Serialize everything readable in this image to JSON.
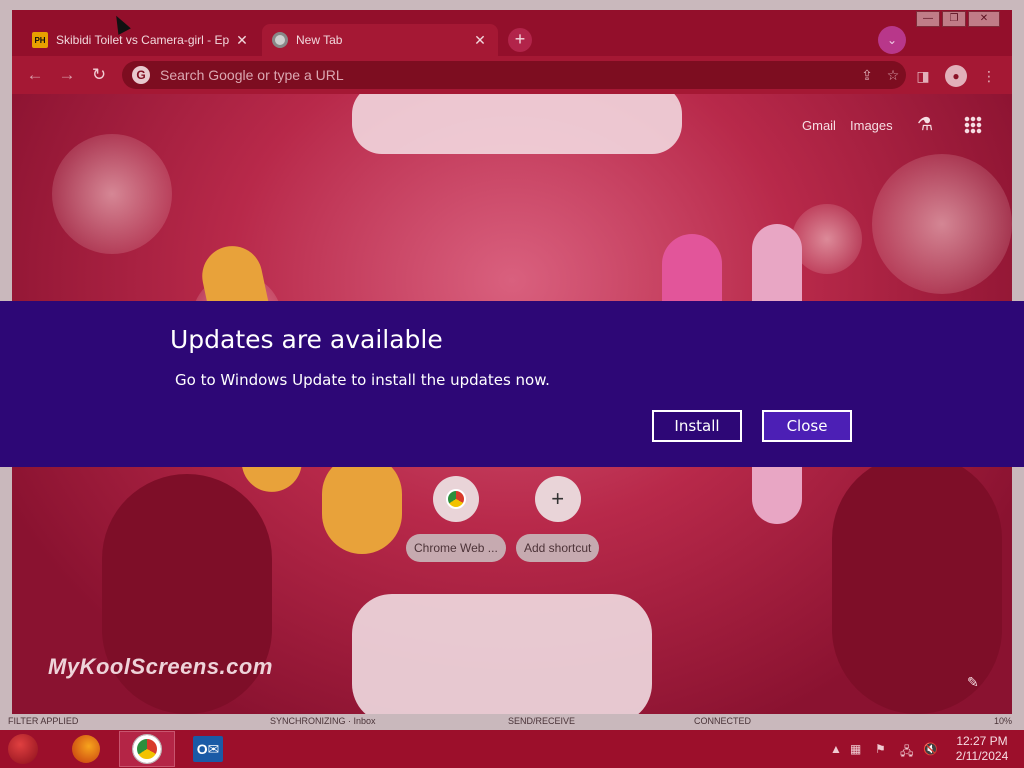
{
  "browser": {
    "tabs": [
      {
        "favicon": "PH",
        "title": "Skibidi Toilet vs Camera-girl - Ep"
      },
      {
        "title": "New Tab"
      }
    ],
    "tab_close": "✕",
    "new_tab_symbol": "+",
    "omnibox": {
      "placeholder": "Search Google or type a URL",
      "google_letter": "G"
    },
    "window_controls": {
      "minimize": "—",
      "restore": "❐",
      "close": "✕"
    }
  },
  "new_tab_page": {
    "links": {
      "gmail": "Gmail",
      "images": "Images"
    },
    "shortcuts": [
      {
        "label": "Chrome Web ..."
      },
      {
        "label": "Add shortcut",
        "symbol": "+"
      }
    ],
    "watermark": "MyKoolScreens.com"
  },
  "update_banner": {
    "title": "Updates are available",
    "message": "Go to Windows Update to install the updates now.",
    "install_label": "Install",
    "close_label": "Close",
    "background_color": "#2d0776"
  },
  "taskbar": {
    "time": "12:27 PM",
    "date": "2/11/2024"
  },
  "statusbar": {
    "left": "FILTER APPLIED",
    "sync": "SYNCHRONIZING · Inbox",
    "send": "SEND/RECEIVE",
    "connected": "CONNECTED",
    "zoom": "10%"
  },
  "icons": {
    "back": "back-arrow-icon",
    "forward": "forward-arrow-icon",
    "reload": "reload-icon",
    "share": "share-icon",
    "bookmark": "star-icon",
    "side_panel": "side-panel-icon",
    "profile": "profile-icon",
    "menu": "kebab-menu-icon",
    "labs": "flask-icon",
    "apps": "apps-grid-icon",
    "customize": "pencil-icon"
  }
}
